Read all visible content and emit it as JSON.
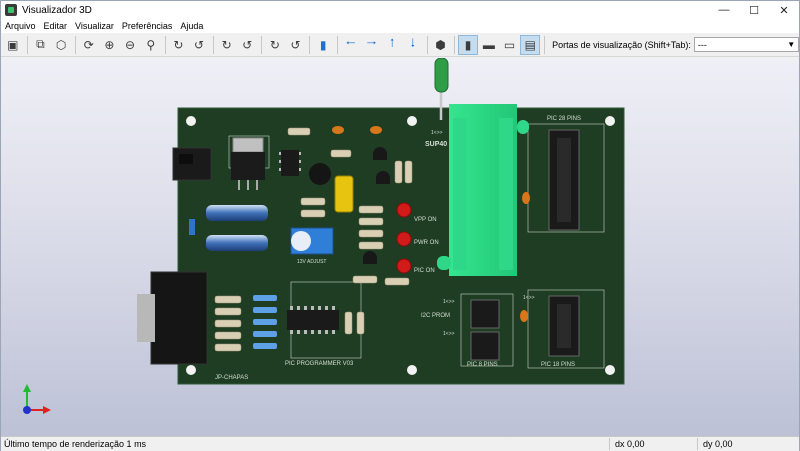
{
  "window": {
    "title": "Visualizador 3D"
  },
  "menu": [
    "Arquivo",
    "Editar",
    "Visualizar",
    "Preferências",
    "Ajuda"
  ],
  "toolbar": {
    "viewport_label": "Portas de visualização (Shift+Tab):",
    "viewport_value": "---"
  },
  "board": {
    "labels": {
      "sup": "SUP40",
      "pic28": "PIC 28 PINS",
      "pic18": "PIC 18 PINS",
      "pic8": "PIC 8 PINS",
      "programmer": "PIC PROGRAMMER V03",
      "author": "JP-CHAPAS",
      "vpp": "VPP ON",
      "pwr": "PWR ON",
      "pic_on": "PIC ON",
      "i2c": "I2C PROM",
      "volt": "13V ADJUST",
      "p1l": "1<>>",
      "p2l": "1<>>",
      "p3l": "1<>>",
      "p4l": "1<>>"
    }
  },
  "status": {
    "render_time": "Último tempo de renderização 1 ms",
    "dx": "dx 0,00",
    "dy": "dy 0,00"
  }
}
